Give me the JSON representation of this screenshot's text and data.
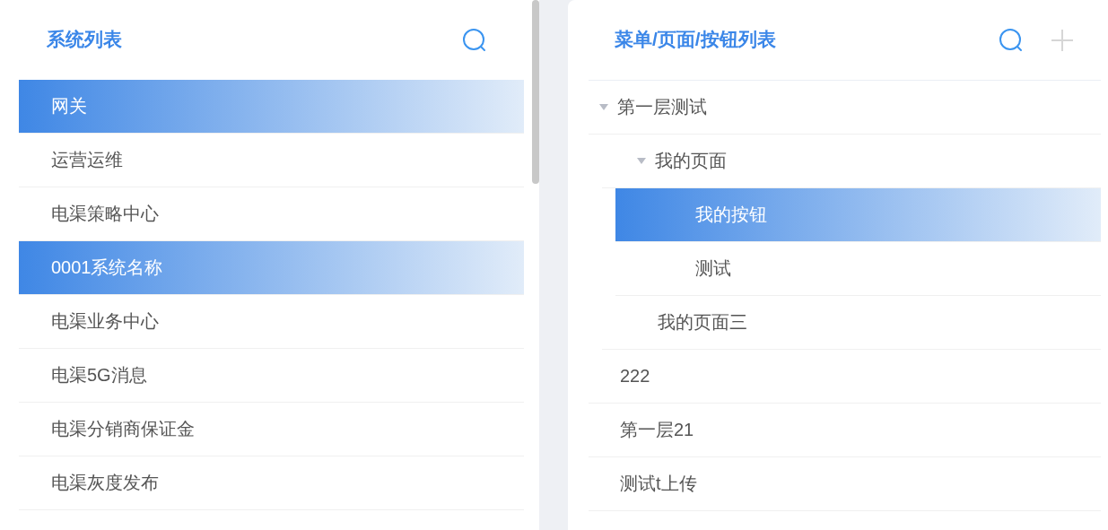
{
  "systems": {
    "title": "系统列表",
    "items": [
      {
        "label": "网关",
        "selected": true
      },
      {
        "label": "运营运维",
        "selected": false
      },
      {
        "label": "电渠策略中心",
        "selected": false
      },
      {
        "label": "0001系统名称",
        "selected": true
      },
      {
        "label": "电渠业务中心",
        "selected": false
      },
      {
        "label": "电渠5G消息",
        "selected": false
      },
      {
        "label": "电渠分销商保证金",
        "selected": false
      },
      {
        "label": "电渠灰度发布",
        "selected": false
      }
    ]
  },
  "menus": {
    "title": "菜单/页面/按钮列表",
    "tree": [
      {
        "label": "第一层测试",
        "selected": false,
        "expanded": true,
        "children": [
          {
            "label": "我的页面",
            "selected": false,
            "expanded": true,
            "children": [
              {
                "label": "我的按钮",
                "selected": true
              },
              {
                "label": "测试",
                "selected": false
              }
            ]
          },
          {
            "label": "我的页面三",
            "selected": false
          }
        ]
      },
      {
        "label": "222",
        "selected": false
      },
      {
        "label": "第一层21",
        "selected": false
      },
      {
        "label": "测试t上传",
        "selected": false
      }
    ]
  }
}
